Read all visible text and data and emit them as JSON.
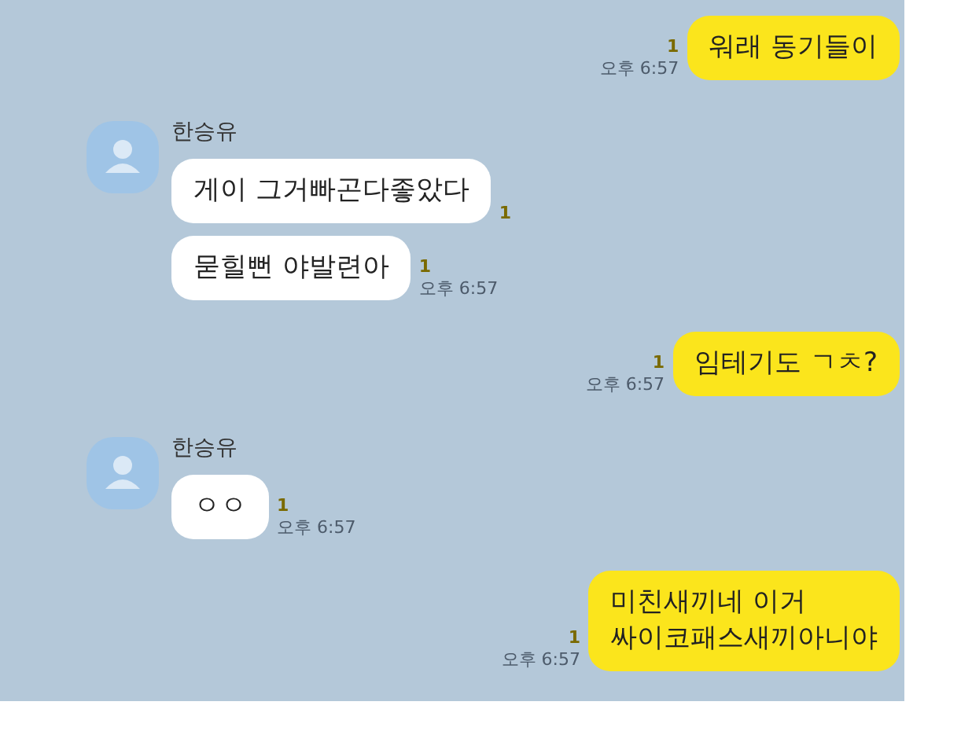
{
  "messages": [
    {
      "kind": "sent",
      "bubbles": [
        {
          "lines": [
            "워래 동기들이"
          ],
          "unread": "1",
          "time": "오후 6:57"
        }
      ]
    },
    {
      "kind": "received",
      "sender": "한승유",
      "bubbles": [
        {
          "lines": [
            "게이 그거빠곤다좋았다"
          ],
          "unread": "1"
        },
        {
          "lines": [
            "묻힐뻔 야발련아"
          ],
          "unread": "1",
          "time": "오후 6:57"
        }
      ]
    },
    {
      "kind": "sent",
      "bubbles": [
        {
          "lines": [
            "임테기도 ㄱㅊ?"
          ],
          "unread": "1",
          "time": "오후 6:57"
        }
      ]
    },
    {
      "kind": "received",
      "sender": "한승유",
      "bubbles": [
        {
          "lines": [
            "ㅇㅇ"
          ],
          "unread": "1",
          "time": "오후 6:57"
        }
      ]
    },
    {
      "kind": "sent",
      "bubbles": [
        {
          "lines": [
            "미친새끼네 이거",
            "싸이코패스새끼아니야"
          ],
          "unread": "1",
          "time": "오후 6:57"
        }
      ]
    }
  ]
}
